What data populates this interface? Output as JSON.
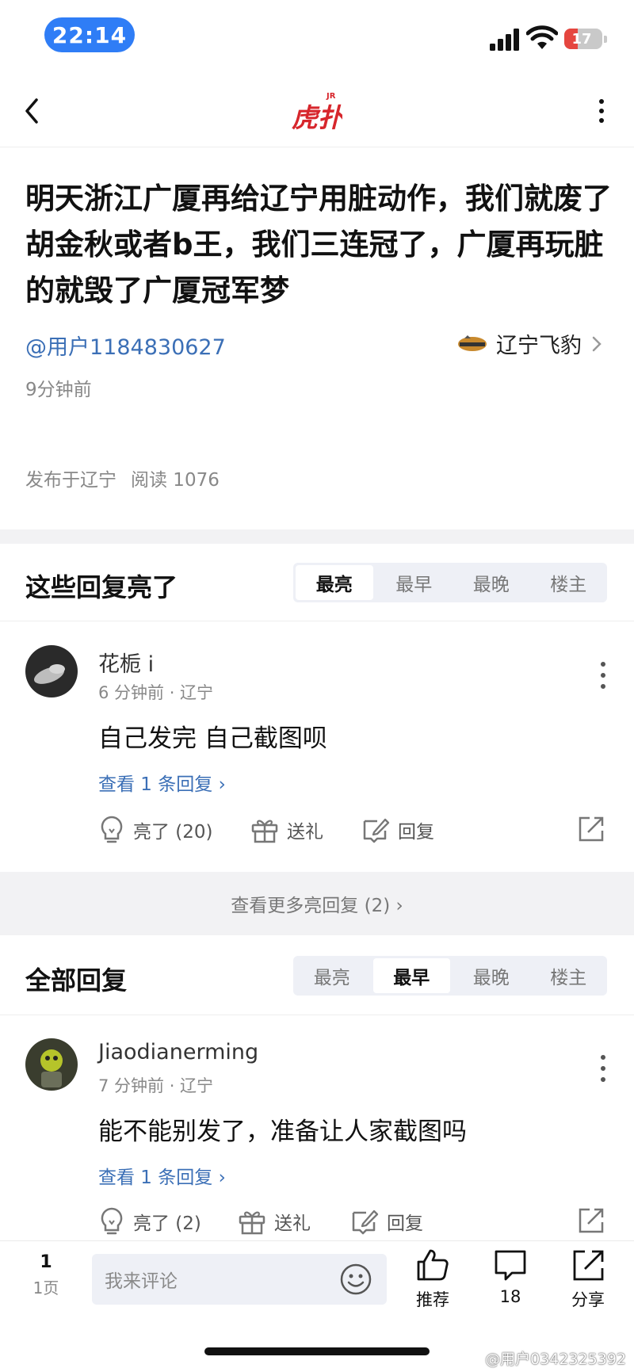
{
  "status": {
    "time": "22:14",
    "battery": "17"
  },
  "nav": {
    "back_icon": "chevron-left-icon",
    "logo": "虎扑",
    "logo_sup": "JR",
    "more_icon": "more-vertical-icon"
  },
  "post": {
    "title": "明天浙江广厦再给辽宁用脏动作，我们就废了胡金秋或者b王，我们三连冠了，广厦再玩脏的就毁了广厦冠军梦",
    "author": "@用户1184830627",
    "team": "辽宁飞豹",
    "time": "9分钟前",
    "published": "发布于辽宁",
    "reads": "阅读 1076"
  },
  "bright": {
    "title": "这些回复亮了",
    "tabs": [
      "最亮",
      "最早",
      "最晚",
      "楼主"
    ],
    "active": 0,
    "comment": {
      "user": "花栀 i",
      "meta": "6 分钟前 · 辽宁",
      "body": "自己发完 自己截图呗",
      "replies": "查看 1 条回复 ›",
      "light": "亮了 (20)",
      "gift": "送礼",
      "reply": "回复"
    },
    "more": "查看更多亮回复 (2) ›"
  },
  "all": {
    "title": "全部回复",
    "tabs": [
      "最亮",
      "最早",
      "最晚",
      "楼主"
    ],
    "active": 1,
    "comment": {
      "user": "Jiaodianerming",
      "meta": "7 分钟前 · 辽宁",
      "body": "能不能别发了，准备让人家截图吗",
      "replies": "查看 1 条回复 ›",
      "light": "亮了 (2)",
      "gift": "送礼",
      "reply": "回复"
    }
  },
  "bottom": {
    "page_num": "1",
    "page_label": "1页",
    "input_placeholder": "我来评论",
    "recommend": "推荐",
    "comments": "18",
    "share": "分享"
  },
  "watermark": "@用户0342325392",
  "colors": {
    "accent_blue": "#3b6fb6",
    "time_pill": "#2f7df6",
    "logo_red": "#d7262c",
    "battery_red": "#e5463f"
  }
}
